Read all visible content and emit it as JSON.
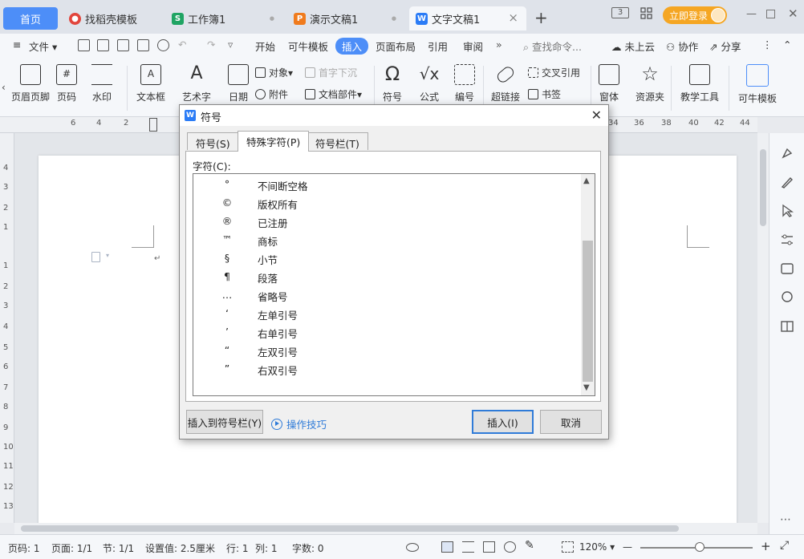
{
  "tabs": {
    "home": "首页",
    "template": "找稻壳模板",
    "sheet": "工作簿1",
    "slides": "演示文稿1",
    "doc": "文字文稿1",
    "sheet_letter": "S",
    "slides_letter": "P",
    "doc_letter": "W",
    "add": "+",
    "close": "×",
    "dot": "●"
  },
  "topright": {
    "badge": "3",
    "login": "立即登录"
  },
  "menu": {
    "file": "文件",
    "items": [
      "开始",
      "可牛模板",
      "插入",
      "页面布局",
      "引用",
      "审阅"
    ],
    "more": "»",
    "search": "查找命令...",
    "cloud": "未上云",
    "collab": "协作",
    "share": "分享"
  },
  "ribbon": {
    "header_footer": "页眉页脚",
    "page_number": "页码",
    "watermark": "水印",
    "textbox": "文本框",
    "wordart": "艺术字",
    "date": "日期",
    "object": "对象",
    "attachment": "附件",
    "dropcap": "首字下沉",
    "docpart": "文档部件",
    "symbol": "符号",
    "formula": "公式",
    "numbering": "编号",
    "hyperlink": "超链接",
    "crossref": "交叉引用",
    "bookmark": "书签",
    "form": "窗体",
    "resource": "资源夹",
    "teaching": "教学工具",
    "keniu": "可牛模板"
  },
  "ruler": {
    "h": [
      "6",
      "4",
      "2",
      "34",
      "36",
      "38",
      "40",
      "42",
      "44"
    ],
    "v": [
      "4",
      "3",
      "2",
      "1",
      "1",
      "2",
      "3",
      "4",
      "5",
      "6",
      "7",
      "8",
      "9",
      "10",
      "11",
      "12",
      "13"
    ]
  },
  "dialog": {
    "title": "符号",
    "tab_symbol": "符号(S)",
    "tab_special": "特殊字符(P)",
    "tab_bar": "符号栏(T)",
    "char_label": "字符(C):",
    "chars": [
      {
        "sym": "°",
        "name": "不间断空格"
      },
      {
        "sym": "©",
        "name": "版权所有"
      },
      {
        "sym": "®",
        "name": "已注册"
      },
      {
        "sym": "™",
        "name": "商标"
      },
      {
        "sym": "§",
        "name": "小节"
      },
      {
        "sym": "¶",
        "name": "段落"
      },
      {
        "sym": "…",
        "name": "省略号"
      },
      {
        "sym": "‘",
        "name": "左单引号"
      },
      {
        "sym": "’",
        "name": "右单引号"
      },
      {
        "sym": "“",
        "name": "左双引号"
      },
      {
        "sym": "”",
        "name": "右双引号"
      }
    ],
    "insert_to_bar": "插入到符号栏(Y)",
    "tips": "操作技巧",
    "insert": "插入(I)",
    "cancel": "取消"
  },
  "status": {
    "page_no": "页码: 1",
    "pages": "页面: 1/1",
    "section": "节: 1/1",
    "setting": "设置值: 2.5厘米",
    "row": "行: 1",
    "col": "列: 1",
    "words": "字数: 0",
    "zoom": "120%",
    "zoom_out": "—",
    "zoom_in": "+"
  },
  "colors": {
    "accent": "#4d8ef8",
    "login": "#f5a623",
    "sheet": "#1fa463",
    "slides": "#f07b1d",
    "doc": "#2b7cf6",
    "template": "#e2453c"
  }
}
